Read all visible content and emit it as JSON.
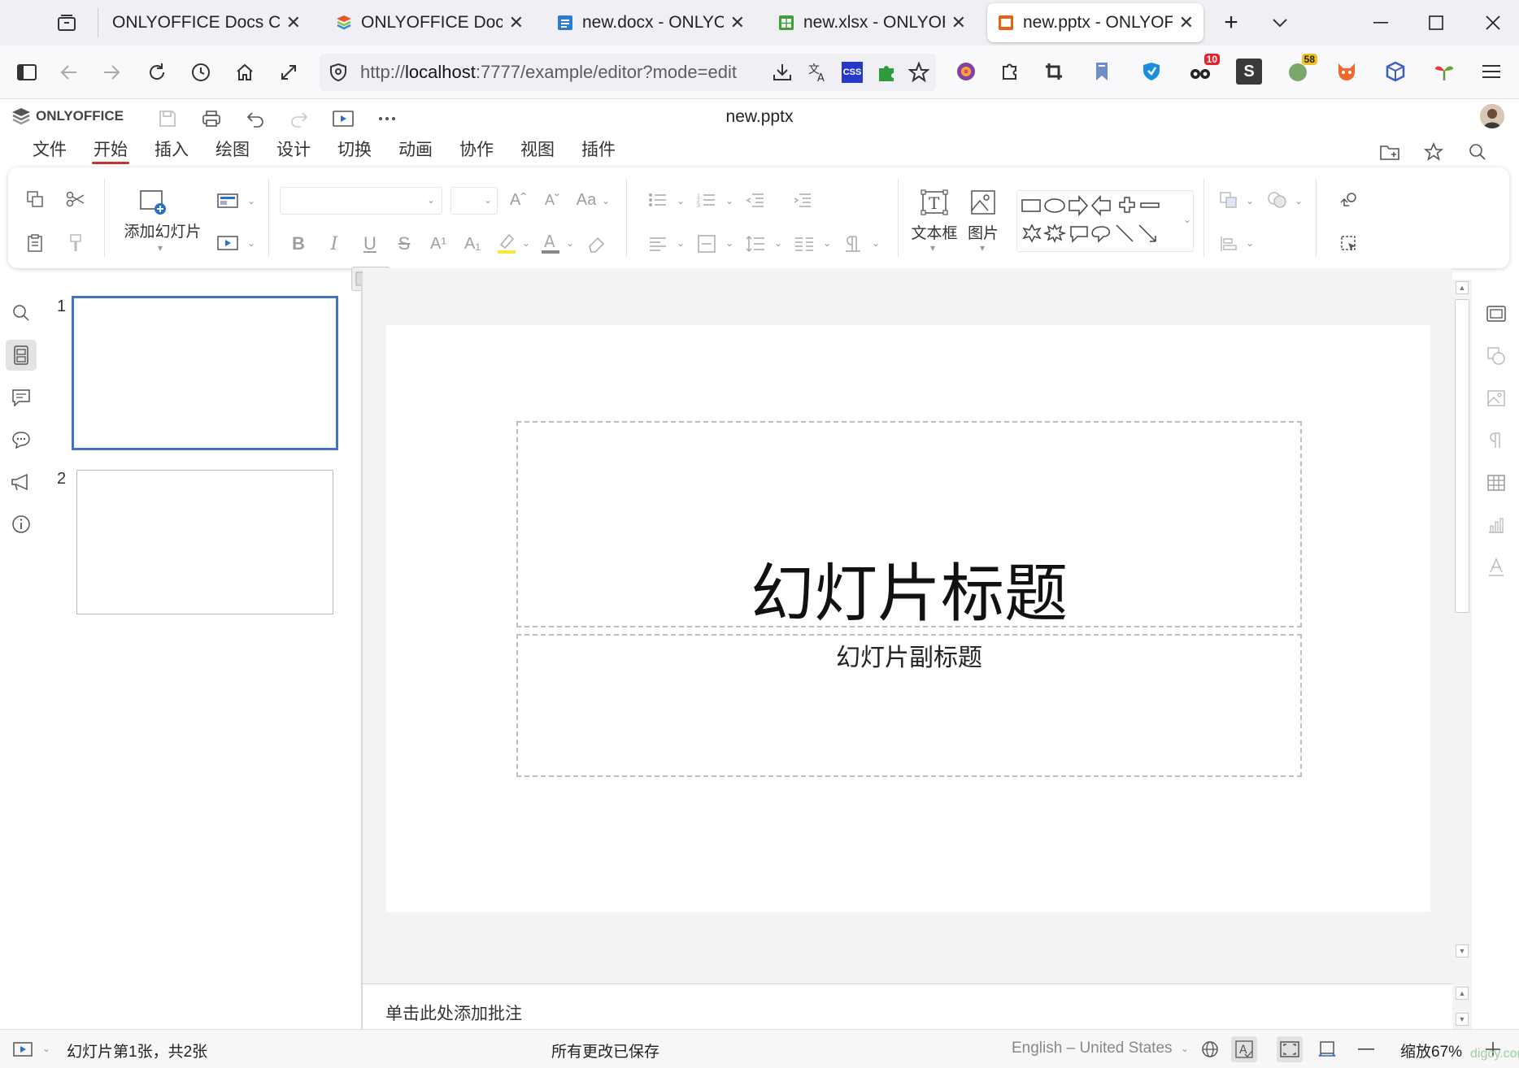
{
  "browser": {
    "tabs": [
      {
        "title": "ONLYOFFICE Docs Comm",
        "favicon": "generic-page-icon",
        "active": false
      },
      {
        "title": "ONLYOFFICE Docume",
        "favicon": "onlyoffice-layers-icon",
        "active": false
      },
      {
        "title": "new.docx - ONLYOFFI",
        "favicon": "document-icon",
        "active": false
      },
      {
        "title": "new.xlsx - ONLYOFFIC",
        "favicon": "spreadsheet-icon",
        "active": false
      },
      {
        "title": "new.pptx - ONLYOFFI",
        "favicon": "presentation-icon",
        "active": true
      }
    ],
    "close_glyph": "✕",
    "new_tab_glyph": "+",
    "url_prefix": "http://",
    "url_host": "localhost",
    "url_rest": ":7777/example/editor?mode=edit",
    "extensions": [
      {
        "name": "download-icon"
      },
      {
        "name": "translate-icon"
      },
      {
        "name": "css-icon",
        "label": "CSS"
      },
      {
        "name": "puzzle-icon"
      },
      {
        "name": "star-icon"
      },
      {
        "name": "color-wheel-icon"
      },
      {
        "name": "extensions-icon"
      },
      {
        "name": "crop-icon"
      },
      {
        "name": "bookmark-icon"
      },
      {
        "name": "shield-ext-icon"
      },
      {
        "name": "glasses-icon",
        "badge": "10",
        "badge_color": "#e0252c"
      },
      {
        "name": "s-ext-icon",
        "label": "S"
      },
      {
        "name": "circle-ext-icon",
        "badge": "58",
        "badge_color": "#f0c020"
      },
      {
        "name": "fox-icon"
      },
      {
        "name": "cube-icon"
      },
      {
        "name": "sprout-icon"
      },
      {
        "name": "hamburger-menu-icon"
      }
    ]
  },
  "app": {
    "brand": "ONLYOFFICE",
    "doc_title": "new.pptx",
    "menu_tabs": [
      "文件",
      "开始",
      "插入",
      "绘图",
      "设计",
      "切换",
      "动画",
      "协作",
      "视图",
      "插件"
    ],
    "active_tab": "开始",
    "accent": "#c0392b"
  },
  "toolbar": {
    "add_slide_label": "添加幻灯片",
    "textbox_label": "文本框",
    "image_label": "图片",
    "font_name": "",
    "font_size": ""
  },
  "slides": {
    "count": 2,
    "numbers": [
      "1",
      "2"
    ],
    "selected": 1,
    "selected_color": "#4472c4"
  },
  "slide": {
    "title": "幻灯片标题",
    "subtitle": "幻灯片副标题"
  },
  "notes": {
    "placeholder": "单击此处添加批注"
  },
  "status": {
    "slide_info": "幻灯片第1张，共2张",
    "save_status": "所有更改已保存",
    "language": "English – United States",
    "zoom": "缩放67%"
  },
  "watermark": "digcy.com"
}
